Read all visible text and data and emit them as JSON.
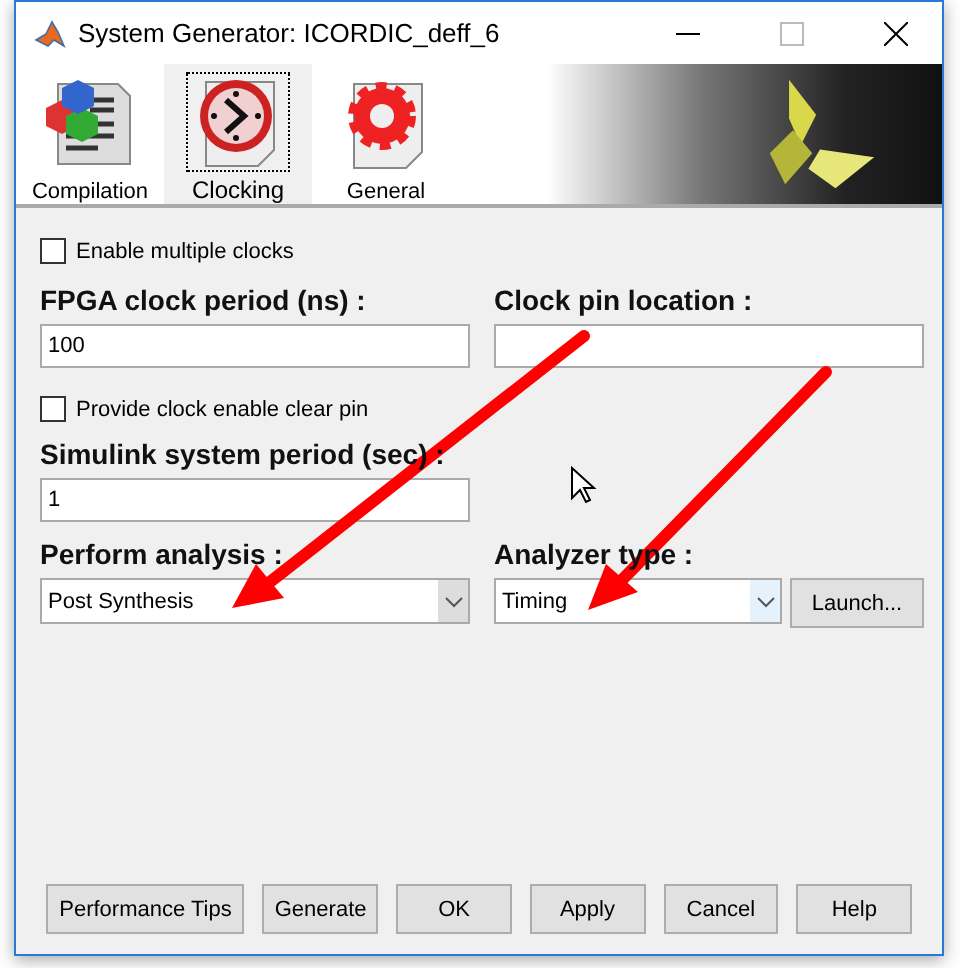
{
  "window": {
    "title": "System Generator: ICORDIC_deff_6"
  },
  "tabs": [
    {
      "label": "Compilation",
      "kind": "compilation",
      "selected": false
    },
    {
      "label": "Clocking",
      "kind": "clocking",
      "selected": true
    },
    {
      "label": "General",
      "kind": "general",
      "selected": false
    }
  ],
  "enable_multiple_clocks": {
    "label": "Enable multiple clocks",
    "checked": false
  },
  "fpga_clock_period": {
    "label": "FPGA clock period (ns) :",
    "value": "100"
  },
  "clock_pin_location": {
    "label": "Clock pin location :"
  },
  "provide_clock_enable_clear_pin": {
    "label": "Provide clock enable clear pin",
    "checked": false
  },
  "simulink_system_period": {
    "label": "Simulink system period (sec) :",
    "value": "1"
  },
  "perform_analysis": {
    "label": "Perform analysis :",
    "value": "Post Synthesis"
  },
  "analyzer_type": {
    "label": "Analyzer type :",
    "value": "Timing"
  },
  "launch_button": "Launch...",
  "buttons": [
    "Performance Tips",
    "Generate",
    "OK",
    "Apply",
    "Cancel",
    "Help"
  ]
}
